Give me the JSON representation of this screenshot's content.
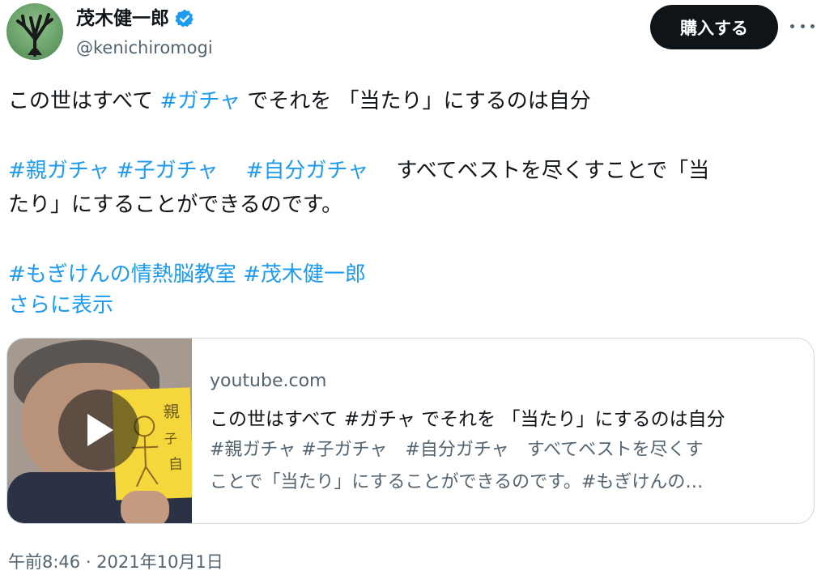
{
  "author": {
    "display_name": "茂木健一郎",
    "handle": "@kenichiromogi",
    "verified_icon": "verified-badge-icon",
    "avatar_icon": "tree-avatar"
  },
  "header": {
    "buy_label": "購入する",
    "more_icon": "more-horizontal-icon"
  },
  "tweet": {
    "line1": {
      "pre": "この世はすべて ",
      "tag": "#ガチャ",
      "post": " でそれを 「当たり」にするのは自分"
    },
    "line2": {
      "tag1": "#親ガチャ",
      "tag2": "#子ガチャ",
      "tag3": "#自分ガチャ",
      "post": "すべてベストを尽くすことで「当"
    },
    "line3": "たり」にすることができるのです。",
    "line4": {
      "tag1": "#もぎけんの情熱脳教室",
      "tag2": "#茂木健一郎"
    },
    "show_more": "さらに表示"
  },
  "card": {
    "domain": "youtube.com",
    "title": "この世はすべて #ガチャ でそれを 「当たり」にするのは自分",
    "desc_line1": "#親ガチャ #子ガチャ　#自分ガチャ　すべてベストを尽くす",
    "desc_line2": "ことで「当たり」にすることができるのです。#もぎけんの…",
    "play_icon": "play-icon",
    "thumbnail_note": "親 子 自"
  },
  "timestamp": "午前8:46 · 2021年10月1日",
  "colors": {
    "link": "#1d9bf0",
    "text": "#0f1419",
    "secondary": "#536471",
    "button_bg": "#0f1419",
    "border": "#cfd9de"
  }
}
